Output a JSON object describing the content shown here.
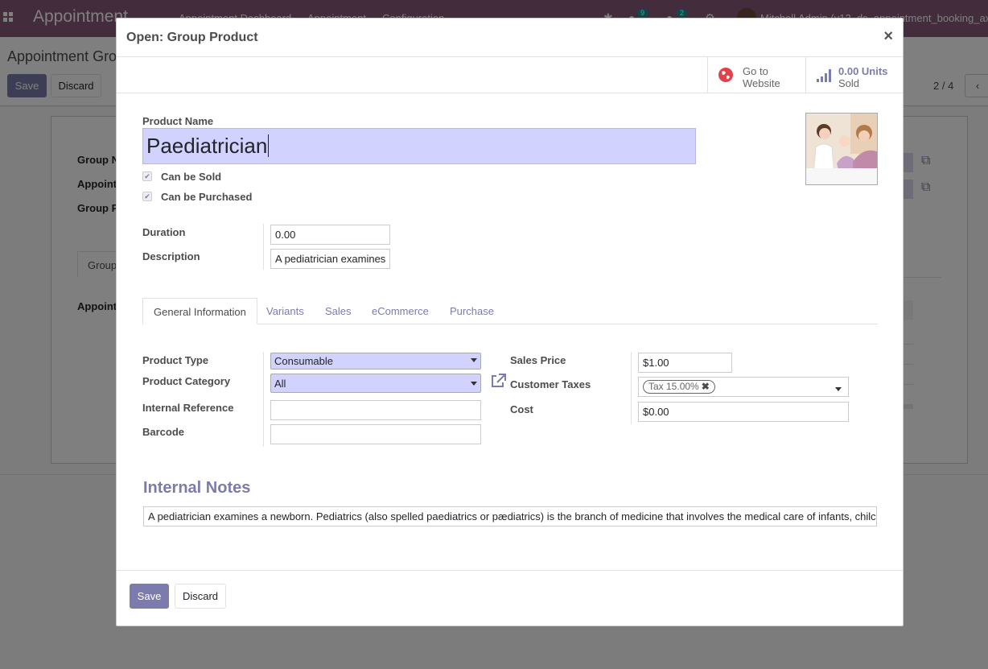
{
  "app": {
    "brand": "Appointment",
    "menus": [
      "Appointment Dashboard",
      "Appointment",
      "Configuration"
    ],
    "chat_count": "9",
    "activity_count": "2",
    "user": "Mitchell Admin (v12_ds_appointment_booking_ax"
  },
  "control_panel": {
    "breadcrumb": "Appointment Gro",
    "save": "Save",
    "discard": "Discard",
    "pager": "2 / 4"
  },
  "background_form": {
    "labels": [
      "Group N",
      "Appoint",
      "Group P",
      "Appoint"
    ],
    "tab": "Group"
  },
  "modal": {
    "title": "Open: Group Product",
    "close": "×",
    "smart_buttons": {
      "website": {
        "line1": "Go to",
        "line2": "Website"
      },
      "sold": {
        "value": "0.00 Units",
        "label": "Sold"
      }
    },
    "product_name_label": "Product Name",
    "product_name": "Paediatrician",
    "can_be_sold": "Can be Sold",
    "can_be_purchased": "Can be Purchased",
    "duration_label": "Duration",
    "duration": "0.00",
    "description_label": "Description",
    "description": "A pediatrician examines",
    "tabs": [
      "General Information",
      "Variants",
      "Sales",
      "eCommerce",
      "Purchase"
    ],
    "general": {
      "product_type_label": "Product Type",
      "product_type": "Consumable",
      "product_category_label": "Product Category",
      "product_category": "All",
      "internal_reference_label": "Internal Reference",
      "internal_reference": "",
      "barcode_label": "Barcode",
      "barcode": "",
      "sales_price_label": "Sales Price",
      "sales_price": "$1.00",
      "customer_taxes_label": "Customer Taxes",
      "customer_tax_tag": "Tax 15.00%",
      "cost_label": "Cost",
      "cost": "$0.00"
    },
    "internal_notes_title": "Internal Notes",
    "internal_notes": "A pediatrician examines a newborn. Pediatrics (also spelled paediatrics or pædiatrics) is the branch of medicine that involves the medical care of infants, chilc",
    "footer": {
      "save": "Save",
      "discard": "Discard"
    }
  }
}
